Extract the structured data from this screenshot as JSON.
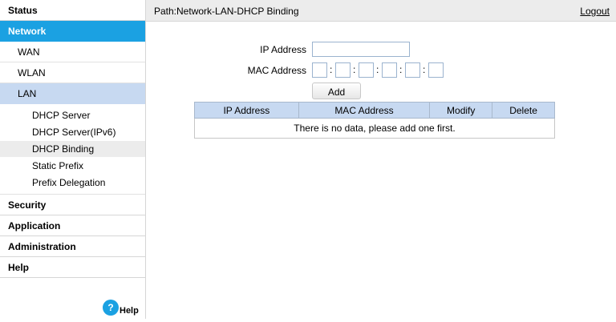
{
  "sidebar": {
    "status": "Status",
    "network": "Network",
    "wan": "WAN",
    "wlan": "WLAN",
    "lan": "LAN",
    "lan_items": [
      "DHCP Server",
      "DHCP Server(IPv6)",
      "DHCP Binding",
      "Static Prefix",
      "Prefix Delegation"
    ],
    "security": "Security",
    "application": "Application",
    "administration": "Administration",
    "help": "Help",
    "help_icon": "?",
    "help_label": "Help"
  },
  "header": {
    "path": "Path:Network-LAN-DHCP Binding",
    "logout": "Logout"
  },
  "form": {
    "ip_label": "IP Address",
    "ip_value": "",
    "mac_label": "MAC Address",
    "mac_values": [
      "",
      "",
      "",
      "",
      "",
      ""
    ],
    "mac_separator": ":",
    "add_label": "Add"
  },
  "table": {
    "columns": [
      "IP Address",
      "MAC Address",
      "Modify",
      "Delete"
    ],
    "empty_message": "There is no data, please add one first."
  },
  "colors": {
    "accent": "#1ba1e2",
    "selected_bg": "#c7d9f1",
    "header_bar": "#ececec"
  }
}
